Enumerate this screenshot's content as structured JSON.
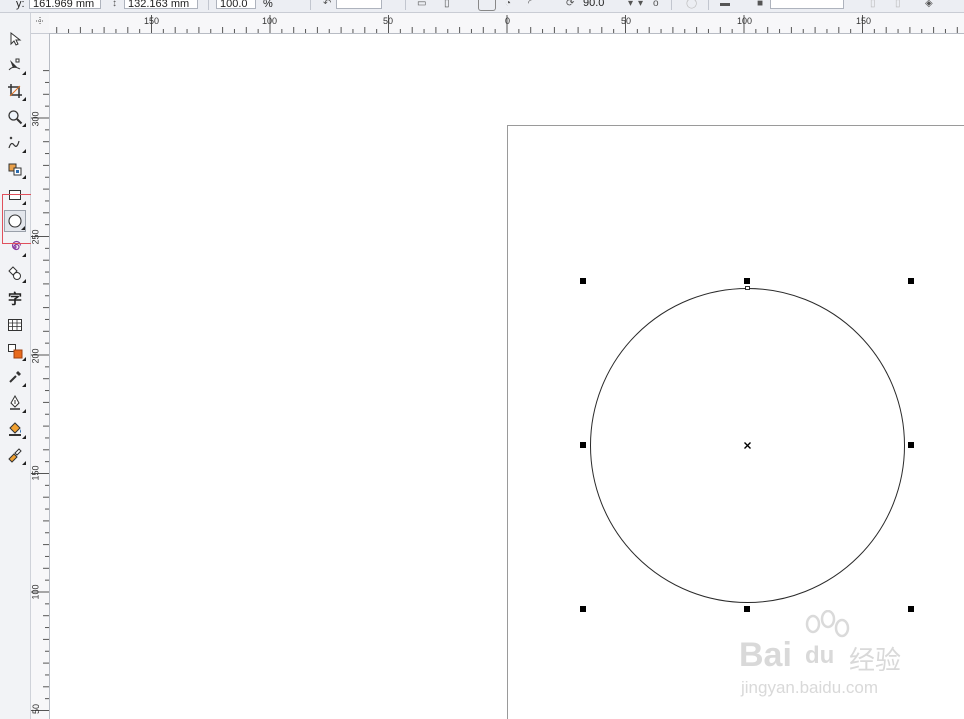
{
  "property_bar": {
    "y_label": "y:",
    "y_value": "161.969 mm",
    "height_value": "132.163 mm",
    "scale_value": "100.0",
    "scale_unit": "%",
    "rotation_value": "90.0"
  },
  "toolbox": {
    "tools": [
      {
        "name": "pick-tool",
        "icon": "pointer-arrow-icon"
      },
      {
        "name": "shape-tool",
        "icon": "shape-edit-icon"
      },
      {
        "name": "crop-tool",
        "icon": "crop-icon"
      },
      {
        "name": "zoom-tool",
        "icon": "magnifier-icon"
      },
      {
        "name": "freehand-tool",
        "icon": "freehand-curve-icon"
      },
      {
        "name": "smart-fill-tool",
        "icon": "smart-fill-icon"
      },
      {
        "name": "rectangle-tool",
        "icon": "rectangle-icon"
      },
      {
        "name": "ellipse-tool",
        "icon": "ellipse-icon",
        "active": true
      },
      {
        "name": "spiral-tool",
        "icon": "spiral-icon"
      },
      {
        "name": "basic-shapes-tool",
        "icon": "basic-shapes-icon"
      },
      {
        "name": "text-tool",
        "icon": "text-icon",
        "label": "字"
      },
      {
        "name": "table-tool",
        "icon": "table-grid-icon"
      },
      {
        "name": "interactive-tool",
        "icon": "blend-icon"
      },
      {
        "name": "eyedropper-tool",
        "icon": "eyedropper-icon"
      },
      {
        "name": "outline-tool",
        "icon": "pen-nib-icon"
      },
      {
        "name": "fill-tool",
        "icon": "paint-bucket-icon"
      },
      {
        "name": "interactive-fill-tool",
        "icon": "interactive-fill-icon"
      }
    ]
  },
  "rulers": {
    "horizontal_labels": [
      "150",
      "100",
      "50",
      "0",
      "50",
      "100",
      "150"
    ],
    "vertical_labels": [
      "300",
      "250",
      "200",
      "150",
      "100",
      "50"
    ]
  },
  "watermark": {
    "brand": "Bai",
    "brand_suffix": "du",
    "product": "经验",
    "url": "jingyan.baidu.com"
  }
}
